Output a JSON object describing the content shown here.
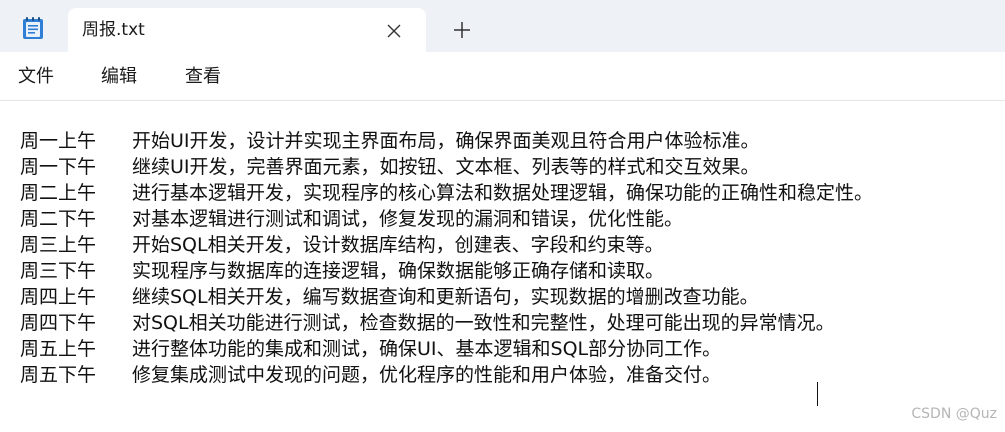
{
  "window": {
    "icon": "notepad-icon",
    "tab_title": "周报.txt",
    "close_icon": "close-icon",
    "new_tab_icon": "plus-icon"
  },
  "menu": {
    "file": "文件",
    "edit": "编辑",
    "view": "查看"
  },
  "document": {
    "lines": [
      {
        "day": "周一上午",
        "text": "开始UI开发，设计并实现主界面布局，确保界面美观且符合用户体验标准。"
      },
      {
        "day": "周一下午",
        "text": "继续UI开发，完善界面元素，如按钮、文本框、列表等的样式和交互效果。"
      },
      {
        "day": "周二上午",
        "text": "进行基本逻辑开发，实现程序的核心算法和数据处理逻辑，确保功能的正确性和稳定性。"
      },
      {
        "day": "周二下午",
        "text": "对基本逻辑进行测试和调试，修复发现的漏洞和错误，优化性能。"
      },
      {
        "day": "周三上午",
        "text": "开始SQL相关开发，设计数据库结构，创建表、字段和约束等。"
      },
      {
        "day": "周三下午",
        "text": "实现程序与数据库的连接逻辑，确保数据能够正确存储和读取。"
      },
      {
        "day": "周四上午",
        "text": "继续SQL相关开发，编写数据查询和更新语句，实现数据的增删改查功能。"
      },
      {
        "day": "周四下午",
        "text": "对SQL相关功能进行测试，检查数据的一致性和完整性，处理可能出现的异常情况。"
      },
      {
        "day": "周五上午",
        "text": "进行整体功能的集成和测试，确保UI、基本逻辑和SQL部分协同工作。"
      },
      {
        "day": "周五下午",
        "text": "修复集成测试中发现的问题，优化程序的性能和用户体验，准备交付。"
      }
    ]
  },
  "watermark": "CSDN @Quz"
}
